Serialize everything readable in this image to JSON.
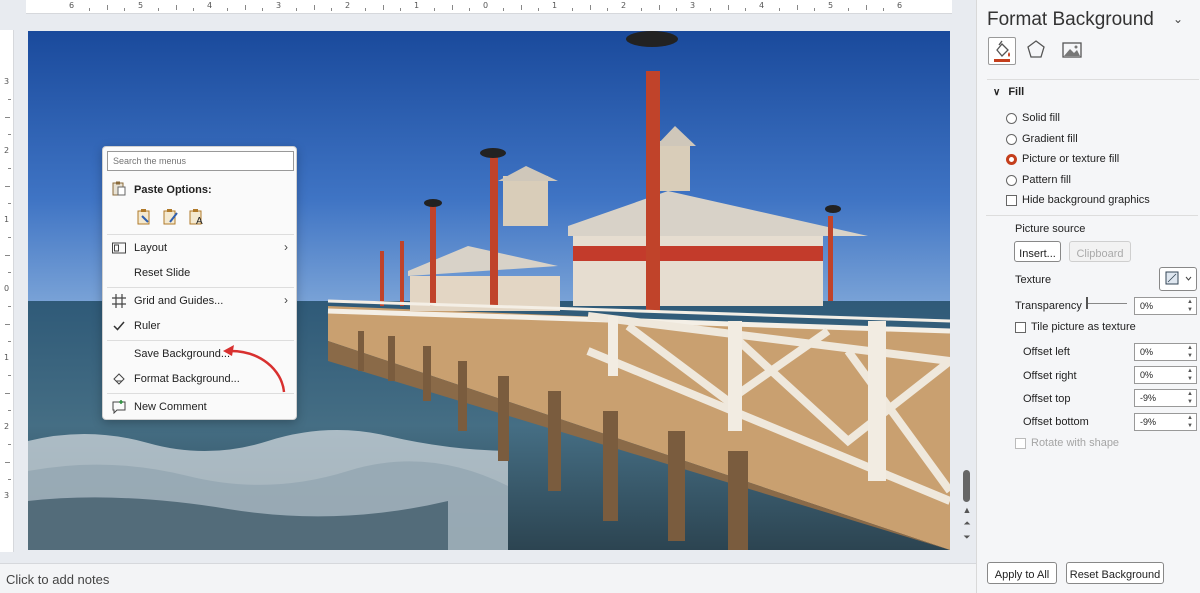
{
  "rulers": {
    "horizontal": [
      "6",
      "5",
      "4",
      "3",
      "2",
      "1",
      "0",
      "1",
      "2",
      "3",
      "4",
      "5",
      "6"
    ],
    "vertical": [
      "3",
      "2",
      "1",
      "0",
      "1",
      "2",
      "3"
    ]
  },
  "notes_placeholder": "Click to add notes",
  "context_menu": {
    "search_placeholder": "Search the menus",
    "paste_options_label": "Paste Options:",
    "items": {
      "layout": "Layout",
      "reset_slide": "Reset Slide",
      "grid_guides": "Grid and Guides...",
      "ruler": "Ruler",
      "save_background": "Save Background...",
      "format_background": "Format Background...",
      "new_comment": "New Comment"
    }
  },
  "pane": {
    "title": "Format Background",
    "section": "Fill",
    "fill_options": {
      "solid": "Solid fill",
      "gradient": "Gradient fill",
      "picture": "Picture or texture fill",
      "pattern": "Pattern fill"
    },
    "selected_fill": "Picture or texture fill",
    "hide_background_graphics": "Hide background graphics",
    "picture_source": "Picture source",
    "insert_button": "Insert...",
    "clipboard_button": "Clipboard",
    "texture_label": "Texture",
    "transparency_label": "Transparency",
    "transparency_value": "0%",
    "tile_label": "Tile picture as texture",
    "offset_left_label": "Offset left",
    "offset_left_value": "0%",
    "offset_right_label": "Offset right",
    "offset_right_value": "0%",
    "offset_top_label": "Offset top",
    "offset_top_value": "-9%",
    "offset_bottom_label": "Offset bottom",
    "offset_bottom_value": "-9%",
    "rotate_label": "Rotate with shape",
    "apply_all_button": "Apply to All",
    "reset_button": "Reset Background"
  },
  "colors": {
    "accent": "#c43e1c",
    "annotation_arrow": "#d8302f"
  },
  "icons": [
    "paste-options-icon",
    "keep-formatting-icon",
    "picture-paste-icon",
    "text-only-paste-icon",
    "layout-icon",
    "grid-icon",
    "checkmark-icon",
    "format-background-icon",
    "new-comment-icon",
    "fill-bucket-icon",
    "pentagon-icon",
    "picture-icon",
    "chevron-down-icon",
    "texture-swatch-icon"
  ]
}
